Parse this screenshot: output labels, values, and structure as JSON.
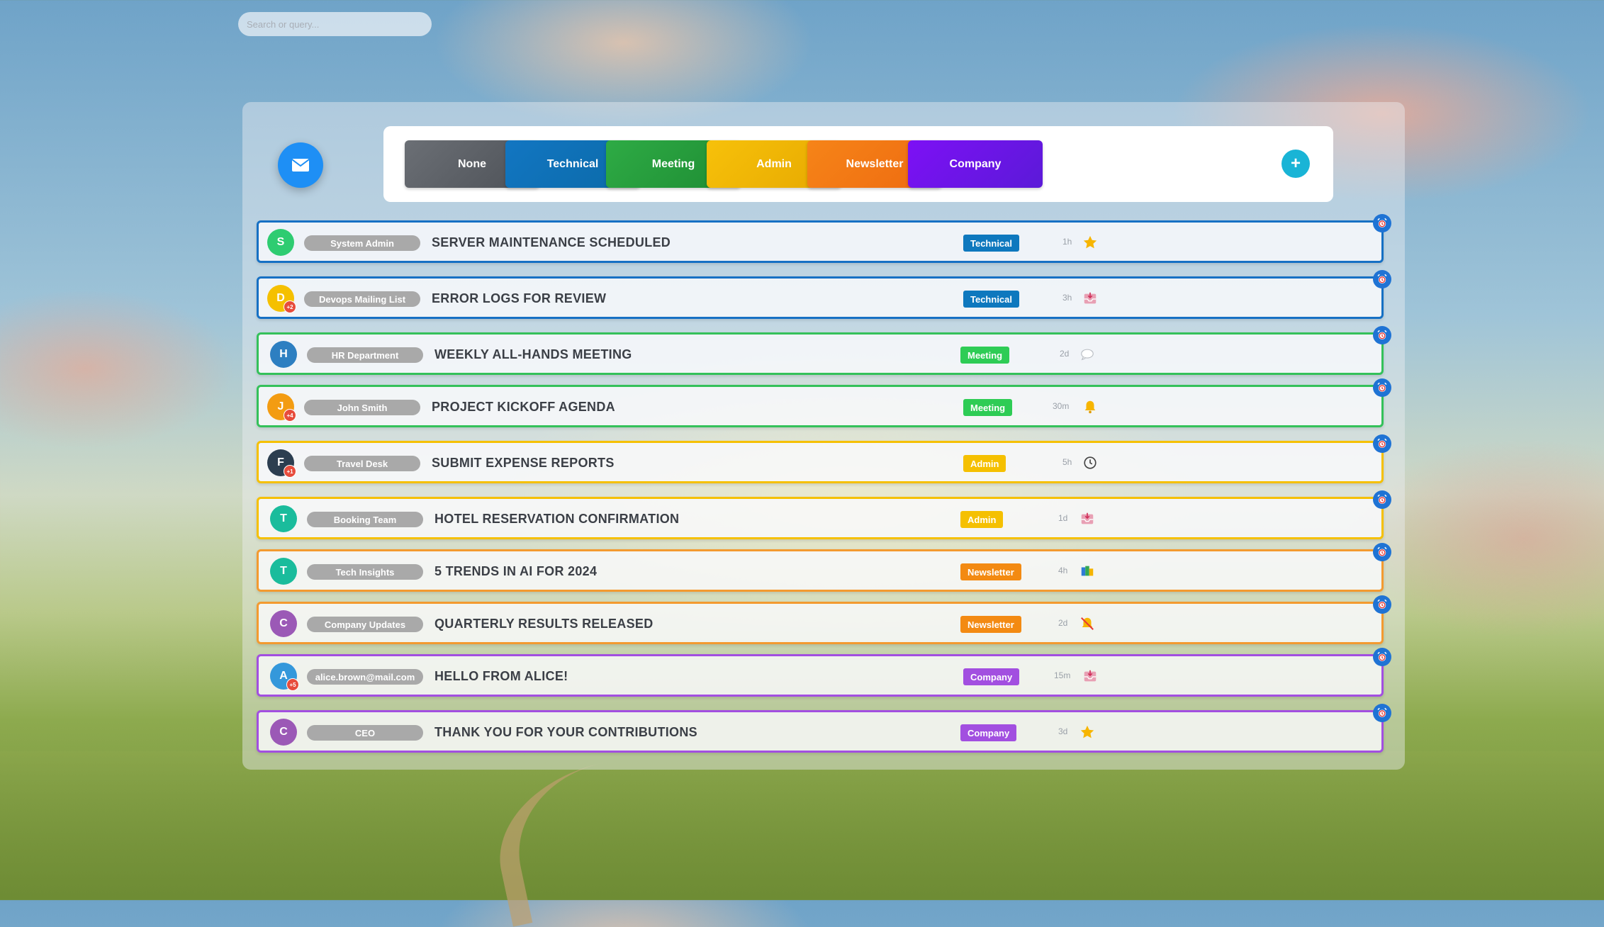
{
  "search": {
    "placeholder": "Search or query..."
  },
  "categories": [
    {
      "label": "None",
      "color": "#5f6368"
    },
    {
      "label": "Technical",
      "color": "#0e78be"
    },
    {
      "label": "Meeting",
      "color": "#28a03c"
    },
    {
      "label": "Admin",
      "color": "#f5b800"
    },
    {
      "label": "Newsletter",
      "color": "#f37a12"
    },
    {
      "label": "Company",
      "color": "#7a12f0"
    }
  ],
  "add_category_label": "+",
  "emails": [
    {
      "initial": "S",
      "avatar_color": "#2ecc71",
      "badge": "",
      "sender": "System Admin",
      "subject": "SERVER MAINTENANCE SCHEDULED",
      "tag": "Technical",
      "tag_color": "#0e78be",
      "border": "#1670c4",
      "time": "1h",
      "icon": "star-icon"
    },
    {
      "initial": "D",
      "avatar_color": "#f5c000",
      "badge": "+2",
      "sender": "Devops Mailing List",
      "subject": "ERROR LOGS FOR REVIEW",
      "tag": "Technical",
      "tag_color": "#0e78be",
      "border": "#1670c4",
      "time": "3h",
      "icon": "inbox-icon"
    },
    {
      "initial": "H",
      "avatar_color": "#2d7fc1",
      "badge": "",
      "sender": "HR Department",
      "subject": "WEEKLY ALL-HANDS MEETING",
      "tag": "Meeting",
      "tag_color": "#2ecc55",
      "border": "#34c15a",
      "time": "2d",
      "icon": "chat-icon"
    },
    {
      "initial": "J",
      "avatar_color": "#f39c12",
      "badge": "+4",
      "sender": "John Smith",
      "subject": "PROJECT KICKOFF AGENDA",
      "tag": "Meeting",
      "tag_color": "#2ecc55",
      "border": "#34c15a",
      "time": "30m",
      "icon": "bell-icon"
    },
    {
      "initial": "F",
      "avatar_color": "#2c3e50",
      "badge": "+1",
      "sender": "Travel Desk",
      "subject": "SUBMIT EXPENSE REPORTS",
      "tag": "Admin",
      "tag_color": "#f5c000",
      "border": "#f5c000",
      "time": "5h",
      "icon": "clock-icon"
    },
    {
      "initial": "T",
      "avatar_color": "#1abc9c",
      "badge": "",
      "sender": "Booking Team",
      "subject": "HOTEL RESERVATION CONFIRMATION",
      "tag": "Admin",
      "tag_color": "#f5c000",
      "border": "#f5c000",
      "time": "1d",
      "icon": "inbox-icon"
    },
    {
      "initial": "T",
      "avatar_color": "#1abc9c",
      "badge": "",
      "sender": "Tech Insights",
      "subject": "5 TRENDS IN AI FOR 2024",
      "tag": "Newsletter",
      "tag_color": "#f38a12",
      "border": "#f39a30",
      "time": "4h",
      "icon": "books-icon"
    },
    {
      "initial": "C",
      "avatar_color": "#9b59b6",
      "badge": "",
      "sender": "Company Updates",
      "subject": "QUARTERLY RESULTS RELEASED",
      "tag": "Newsletter",
      "tag_color": "#f38a12",
      "border": "#f39a30",
      "time": "2d",
      "icon": "muted-bell-icon"
    },
    {
      "initial": "A",
      "avatar_color": "#3498db",
      "badge": "+5",
      "sender": "alice.brown@mail.com",
      "subject": "HELLO FROM ALICE!",
      "tag": "Company",
      "tag_color": "#a24fe0",
      "border": "#a24fe0",
      "time": "15m",
      "icon": "inbox-icon"
    },
    {
      "initial": "C",
      "avatar_color": "#9b59b6",
      "badge": "",
      "sender": "CEO",
      "subject": "THANK YOU FOR YOUR CONTRIBUTIONS",
      "tag": "Company",
      "tag_color": "#a24fe0",
      "border": "#a24fe0",
      "time": "3d",
      "icon": "star-icon"
    }
  ]
}
